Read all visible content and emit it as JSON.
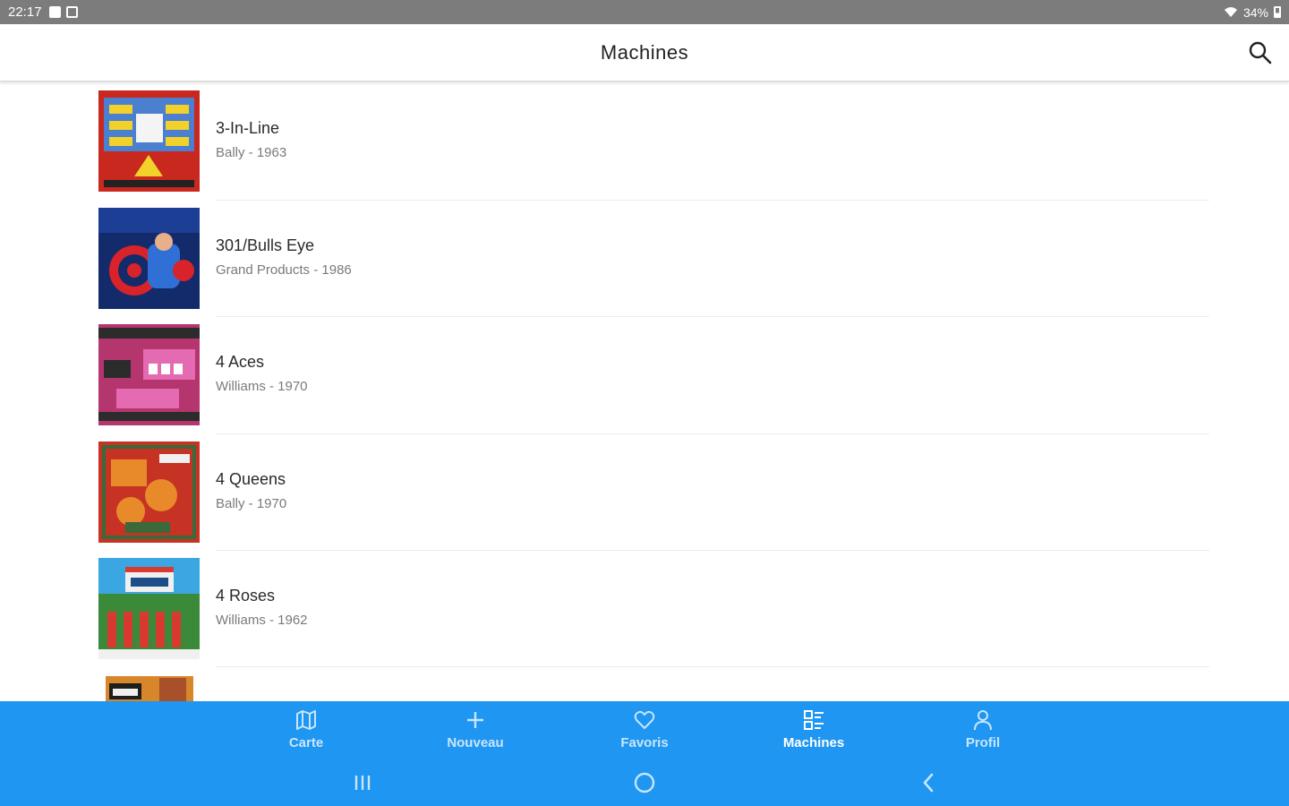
{
  "status_bar": {
    "time": "22:17",
    "battery": "34%"
  },
  "app_bar": {
    "title": "Machines",
    "search_icon": "search-icon"
  },
  "machines": [
    {
      "name": "3-In-Line",
      "meta": "Bally - 1963",
      "thumb_colors": [
        "#c8281e",
        "#f2d22a",
        "#4b7fd0"
      ]
    },
    {
      "name": "301/Bulls Eye",
      "meta": "Grand Products - 1986",
      "thumb_colors": [
        "#132a6b",
        "#d8232a",
        "#2f6fd6"
      ]
    },
    {
      "name": "4 Aces",
      "meta": "Williams - 1970",
      "thumb_colors": [
        "#b5366f",
        "#e46bb1",
        "#2c2c2c"
      ]
    },
    {
      "name": "4 Queens",
      "meta": "Bally - 1970",
      "thumb_colors": [
        "#c63224",
        "#e88a2a",
        "#3a6a3a"
      ]
    },
    {
      "name": "4 Roses",
      "meta": "Williams - 1962",
      "thumb_colors": [
        "#3aa7e2",
        "#d83a2f",
        "#f0f0f0"
      ]
    }
  ],
  "bottom_nav": {
    "items": [
      {
        "label": "Carte",
        "icon": "map-icon"
      },
      {
        "label": "Nouveau",
        "icon": "plus-icon"
      },
      {
        "label": "Favoris",
        "icon": "heart-icon"
      },
      {
        "label": "Machines",
        "icon": "machines-icon"
      },
      {
        "label": "Profil",
        "icon": "profile-icon"
      }
    ],
    "active": "Machines"
  },
  "system_nav": {
    "recent_icon": "recent-apps-icon",
    "home_icon": "home-icon",
    "back_icon": "back-icon"
  },
  "colors": {
    "accent": "#1e96f2",
    "status_bar": "#7c7c7c"
  }
}
